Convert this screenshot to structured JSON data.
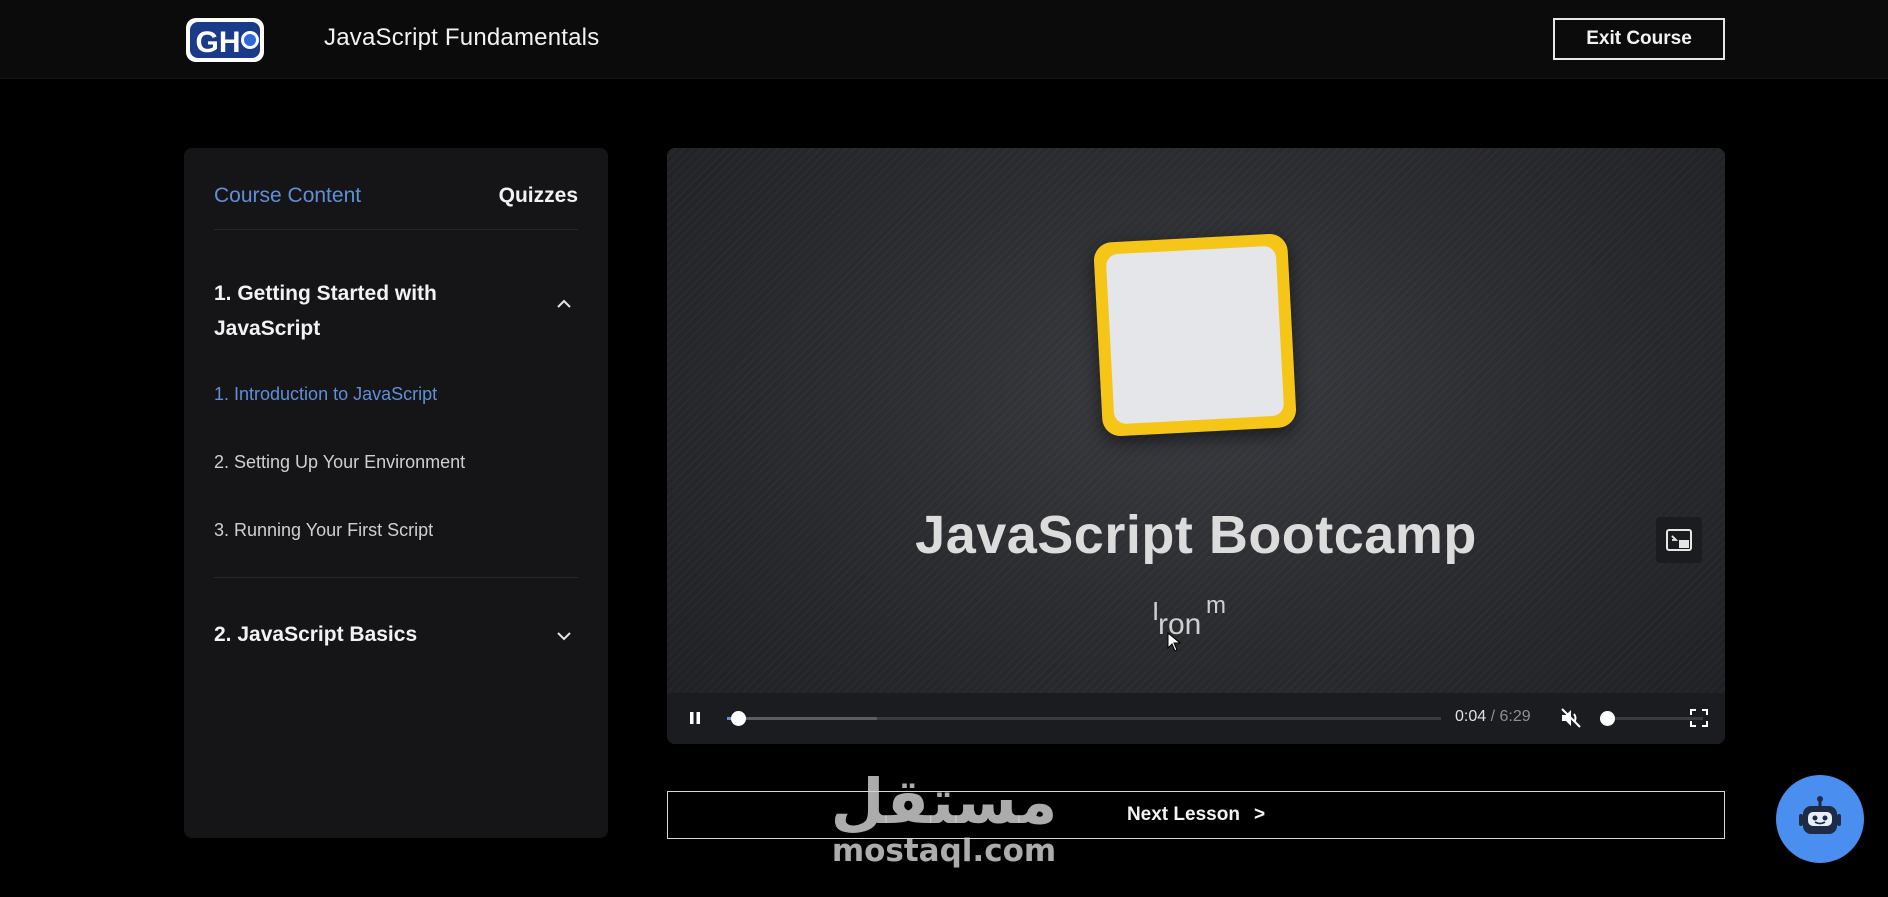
{
  "header": {
    "logo_text": "GH",
    "course_title": "JavaScript Fundamentals",
    "exit_label": "Exit Course"
  },
  "sidebar": {
    "tabs": [
      {
        "label": "Course Content",
        "active": true
      },
      {
        "label": "Quizzes",
        "active": false
      }
    ],
    "sections": [
      {
        "title": "1. Getting Started with JavaScript",
        "expanded": true,
        "lessons": [
          {
            "label": "1. Introduction to JavaScript",
            "active": true
          },
          {
            "label": "2. Setting Up Your Environment",
            "active": false
          },
          {
            "label": "3. Running Your First Script",
            "active": false
          }
        ]
      },
      {
        "title": "2. JavaScript Basics",
        "expanded": false,
        "lessons": []
      }
    ]
  },
  "video": {
    "title": "JavaScript Bootcamp",
    "subtitle_fragment": "ron",
    "subtitle_superscript": "m",
    "subtitle_lead": "I",
    "current_time": "0:04",
    "separator": "/",
    "duration": "6:29",
    "progress": 0.01,
    "buffered": 0.21,
    "muted": true,
    "volume": 0.0
  },
  "next_lesson": {
    "label": "Next Lesson",
    "arrow": ">"
  },
  "watermark": {
    "arabic": "مستقل",
    "latin": "mostaql.com"
  },
  "colors": {
    "accent": "#5f8fd9",
    "js_yellow": "#f5c518",
    "chatbot": "#4a8ff0"
  }
}
